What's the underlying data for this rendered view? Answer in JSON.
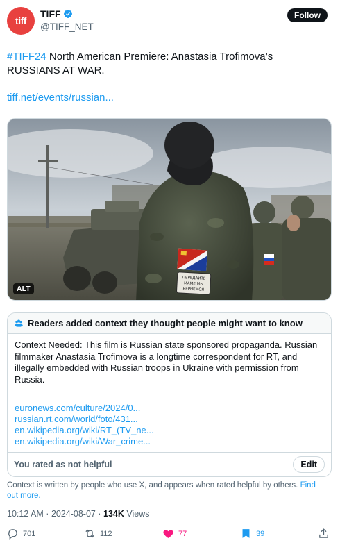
{
  "account": {
    "avatar_text": "tiff",
    "name": "TIFF",
    "handle": "@TIFF_NET"
  },
  "follow_label": "Follow",
  "tweet": {
    "hashtag": "#TIFF24",
    "text": " North American Premiere: Anastasia Trofimova’s RUSSIANS AT WAR.",
    "link": "tiff.net/events/russian..."
  },
  "media": {
    "alt_label": "ALT",
    "patch_text": "ПЕРЕДАЙТЕ МАМЕ МЫ ВЕРНЁМСЯ"
  },
  "community_note": {
    "heading": "Readers added context they thought people might want to know",
    "body": "Context Needed: This film is Russian state sponsored propaganda. Russian filmmaker Anastasia Trofimova is a longtime correspondent for RT, and illegally embedded with Russian troops in Ukraine with permission from Russia.",
    "links": [
      "euronews.com/culture/2024/0...",
      "russian.rt.com/world/foto/431...",
      "en.wikipedia.org/wiki/RT_(TV_ne...",
      "en.wikipedia.org/wiki/War_crime..."
    ],
    "rating_text": "You rated as not helpful",
    "edit_label": "Edit"
  },
  "context_disclaimer": {
    "text": "Context is written by people who use X, and appears when rated helpful by others.",
    "link": "Find out more."
  },
  "meta": {
    "time": "10:12 AM",
    "separator": " · ",
    "date": "2024-08-07",
    "separator2": " · ",
    "views_count": "134K",
    "views_label": " Views"
  },
  "actions": {
    "replies": "701",
    "reposts": "112",
    "likes": "77",
    "bookmarks": "39"
  },
  "colors": {
    "accent": "#1d9bf0",
    "like": "#f91880",
    "bookmark": "#1d9bf0",
    "avatar": "#e8413f"
  }
}
